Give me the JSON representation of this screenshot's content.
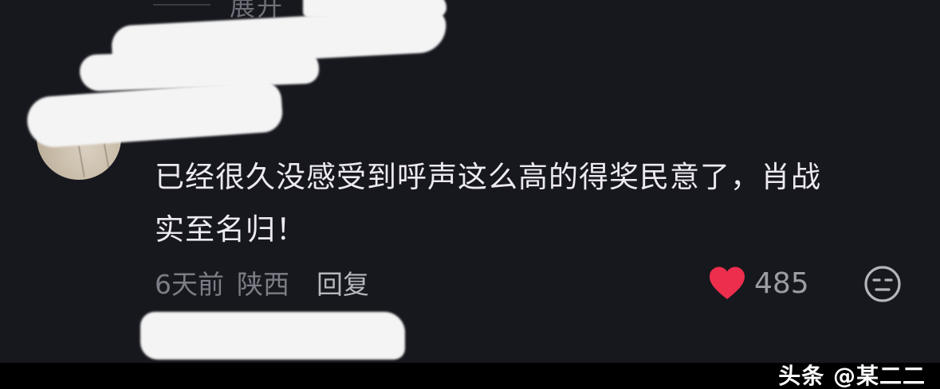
{
  "thread": {
    "expand_label": "展开"
  },
  "comment": {
    "text_line1": "已经很久没感受到呼声这么高的得奖民意了，肖战",
    "text_line2": "实至名归！",
    "time": "6天前",
    "location": "陕西",
    "reply_label": "回复",
    "likes": "485",
    "like_icon": "heart-icon",
    "like_color": "#ee2e4d",
    "reaction_icon": "emoji-icon"
  },
  "watermark": {
    "text": "头条 @某二二"
  },
  "colors": {
    "background": "#17181e",
    "text": "#eceaf0",
    "muted": "#7c7d86"
  }
}
